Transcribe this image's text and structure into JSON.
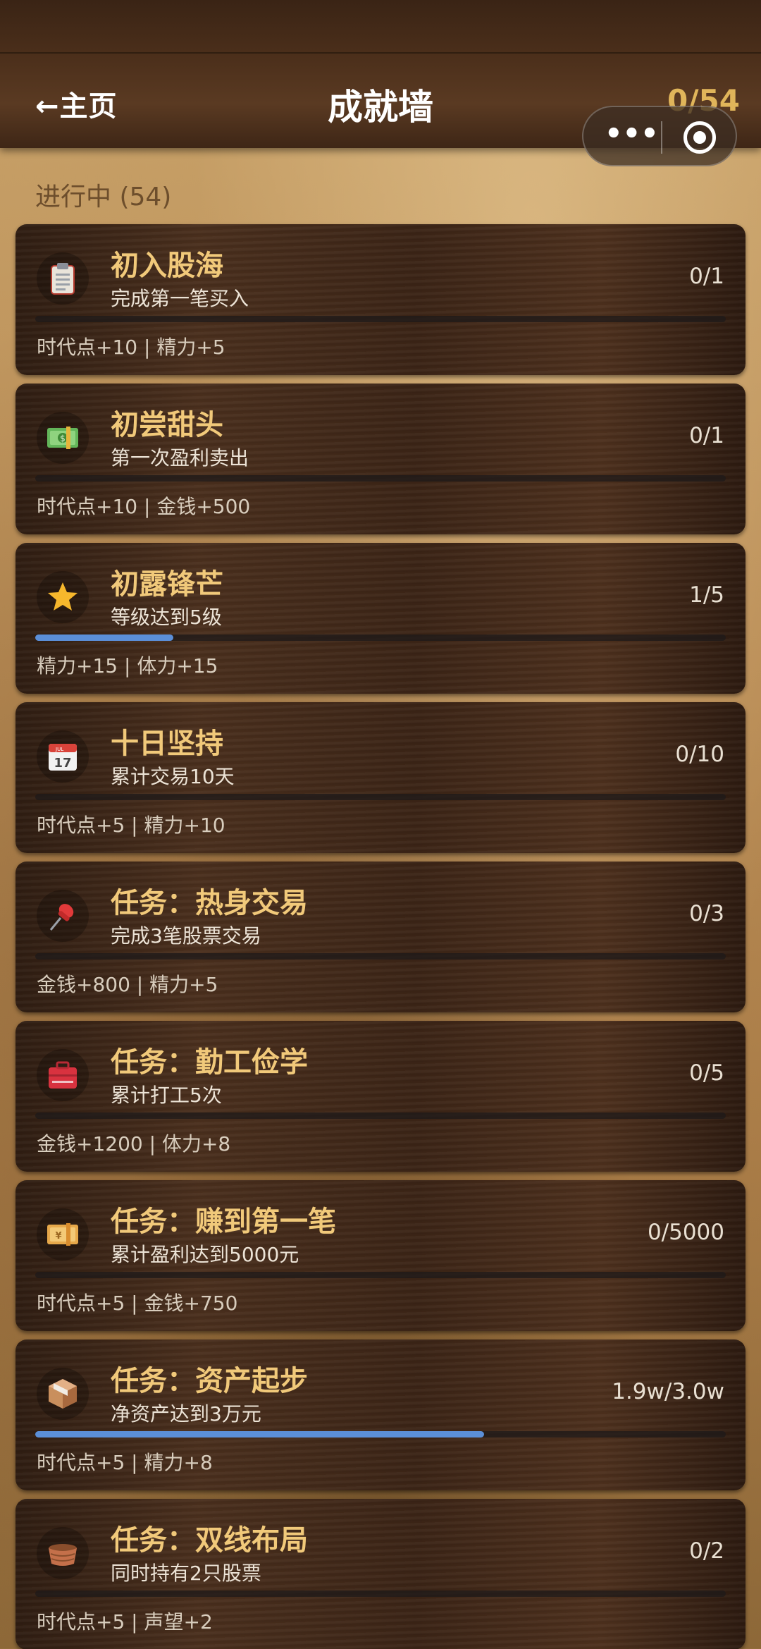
{
  "header": {
    "back_label": "←主页",
    "title": "成就墙",
    "count": "0/54"
  },
  "section_label": "进行中 (54)",
  "cards": [
    {
      "icon": "clipboard-icon",
      "title": "初入股海",
      "desc": "完成第一笔买入",
      "progress": "0/1",
      "fill": 0,
      "reward": "时代点+10 | 精力+5"
    },
    {
      "icon": "money-icon",
      "title": "初尝甜头",
      "desc": "第一次盈利卖出",
      "progress": "0/1",
      "fill": 0,
      "reward": "时代点+10 | 金钱+500"
    },
    {
      "icon": "star-icon",
      "title": "初露锋芒",
      "desc": "等级达到5级",
      "progress": "1/5",
      "fill": 0.2,
      "reward": "精力+15 | 体力+15"
    },
    {
      "icon": "calendar-icon",
      "title": "十日坚持",
      "desc": "累计交易10天",
      "progress": "0/10",
      "fill": 0,
      "reward": "时代点+5 | 精力+10"
    },
    {
      "icon": "pushpin-icon",
      "title": "任务：热身交易",
      "desc": "完成3笔股票交易",
      "progress": "0/3",
      "fill": 0,
      "reward": "金钱+800 | 精力+5"
    },
    {
      "icon": "toolbox-icon",
      "title": "任务：勤工俭学",
      "desc": "累计打工5次",
      "progress": "0/5",
      "fill": 0,
      "reward": "金钱+1200 | 体力+8"
    },
    {
      "icon": "yen-icon",
      "title": "任务：赚到第一笔",
      "desc": "累计盈利达到5000元",
      "progress": "0/5000",
      "fill": 0,
      "reward": "时代点+5 | 金钱+750"
    },
    {
      "icon": "package-icon",
      "title": "任务：资产起步",
      "desc": "净资产达到3万元",
      "progress": "1.9w/3.0w",
      "fill": 0.65,
      "reward": "时代点+5 | 精力+8"
    },
    {
      "icon": "basket-icon",
      "title": "任务：双线布局",
      "desc": "同时持有2只股票",
      "progress": "0/2",
      "fill": 0,
      "reward": "时代点+5 | 声望+2"
    }
  ]
}
